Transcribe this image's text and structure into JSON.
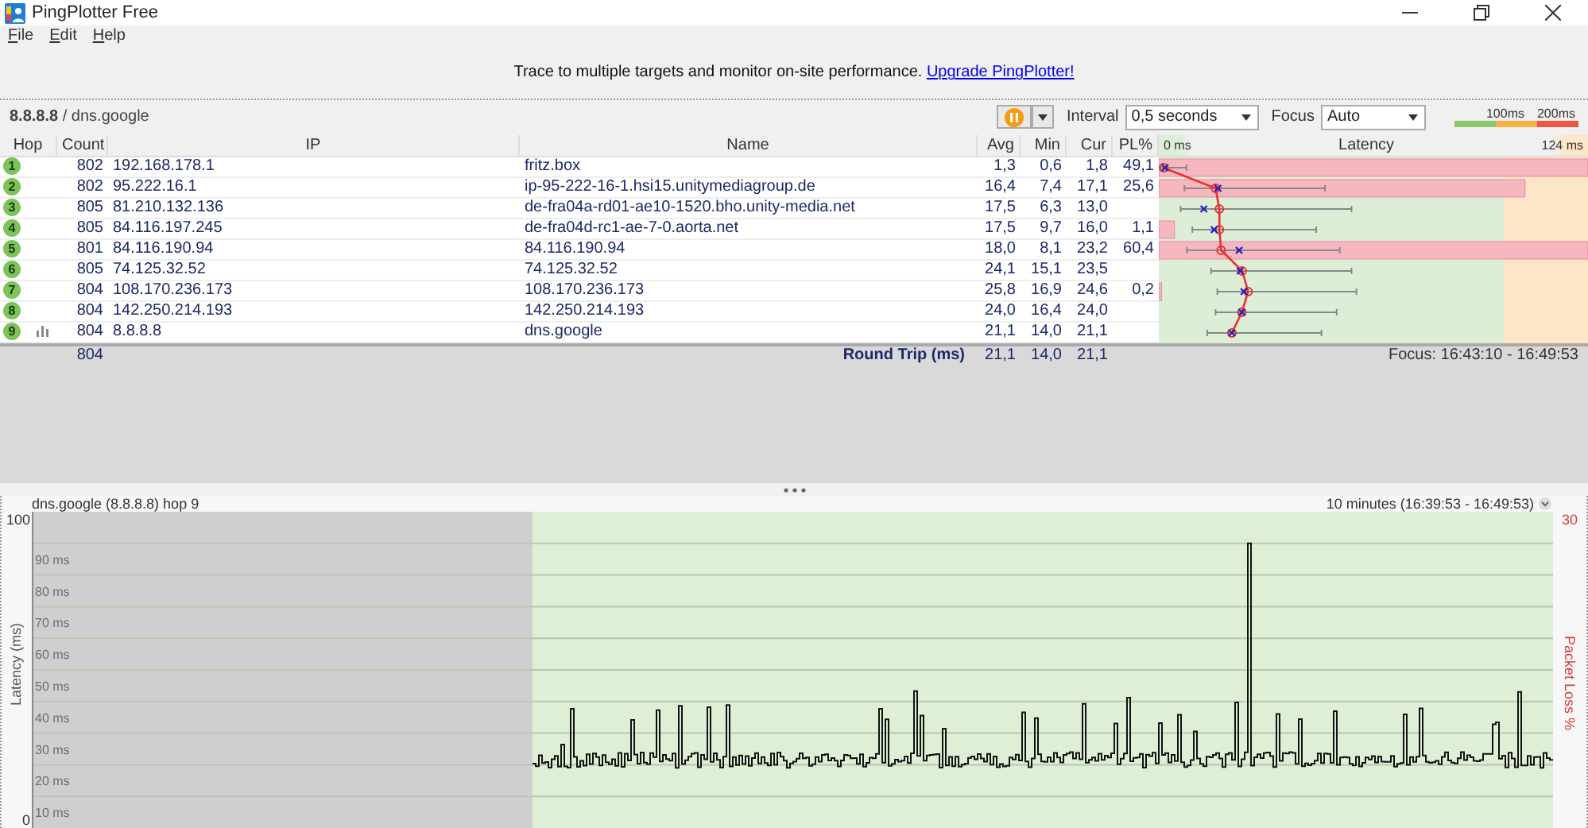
{
  "window": {
    "title": "PingPlotter Free"
  },
  "menu": [
    {
      "label": "File"
    },
    {
      "label": "Edit"
    },
    {
      "label": "Help"
    }
  ],
  "banner": {
    "text": "Trace to multiple targets and monitor on-site performance.",
    "link": "Upgrade PingPlotter!"
  },
  "target": {
    "title": "**8.8.8.8** / dns.google",
    "interval": {
      "label": "Interval",
      "value": "0,5 seconds"
    },
    "focus": {
      "label": "Focus",
      "value": "Auto"
    },
    "legend": [
      "100ms",
      "200ms"
    ]
  },
  "table": {
    "columns": [
      "Hop",
      "Count",
      "IP",
      "Name",
      "Avg",
      "Min",
      "Cur",
      "PL%"
    ],
    "latency_header": {
      "min": "0 ms",
      "title": "Latency",
      "max": "124 ms"
    },
    "rows": [
      {
        "hop": "1",
        "count": "802",
        "ip": "192.168.178.1",
        "name": "fritz.box",
        "avg": "1,3",
        "min": "0,6",
        "cur": "1,8",
        "pl": "49,1",
        "graphed": false
      },
      {
        "hop": "2",
        "count": "802",
        "ip": "95.222.16.1",
        "name": "ip-95-222-16-1.hsi15.unitymediagroup.de",
        "avg": "16,4",
        "min": "7,4",
        "cur": "17,1",
        "pl": "25,6",
        "graphed": false
      },
      {
        "hop": "3",
        "count": "805",
        "ip": "81.210.132.136",
        "name": "de-fra04a-rd01-ae10-1520.bho.unity-media.net",
        "avg": "17,5",
        "min": "6,3",
        "cur": "13,0",
        "graphed": false
      },
      {
        "hop": "4",
        "count": "805",
        "ip": "84.116.197.245",
        "name": "de-fra04d-rc1-ae-7-0.aorta.net",
        "avg": "17,5",
        "min": "9,7",
        "cur": "16,0",
        "pl": "1,1",
        "graphed": false
      },
      {
        "hop": "5",
        "count": "801",
        "ip": "84.116.190.94",
        "name": "84.116.190.94",
        "avg": "18,0",
        "min": "8,1",
        "cur": "23,2",
        "pl": "60,4",
        "graphed": false
      },
      {
        "hop": "6",
        "count": "805",
        "ip": "74.125.32.52",
        "name": "74.125.32.52",
        "avg": "24,1",
        "min": "15,1",
        "cur": "23,5",
        "graphed": false
      },
      {
        "hop": "7",
        "count": "804",
        "ip": "108.170.236.173",
        "name": "108.170.236.173",
        "avg": "25,8",
        "min": "16,9",
        "cur": "24,6",
        "pl": "0,2",
        "graphed": false
      },
      {
        "hop": "8",
        "count": "804",
        "ip": "142.250.214.193",
        "name": "142.250.214.193",
        "avg": "24,0",
        "min": "16,4",
        "cur": "24,0",
        "graphed": false
      },
      {
        "hop": "9",
        "count": "804",
        "ip": "8.8.8.8",
        "name": "dns.google",
        "avg": "21,1",
        "min": "14,0",
        "cur": "21,1",
        "graphed": true
      }
    ],
    "summary": {
      "count": "804",
      "label": "Round Trip (ms)",
      "avg": "21,1",
      "min": "14,0",
      "cur": "21,1",
      "focus": "Focus: 16:43:10 - 16:49:53"
    }
  },
  "graph": {
    "title": "dns.google (8.8.8.8) hop 9",
    "range": "10 minutes (16:39:53 - 16:49:53)",
    "y_max": "100",
    "y_min": "0",
    "y_label": "Latency (ms)",
    "loss_max": "30",
    "loss_label": "Packet Loss %",
    "grid_labels": [
      "90 ms",
      "80 ms",
      "70 ms",
      "60 ms",
      "50 ms",
      "40 ms",
      "30 ms",
      "20 ms",
      "10 ms"
    ]
  }
}
